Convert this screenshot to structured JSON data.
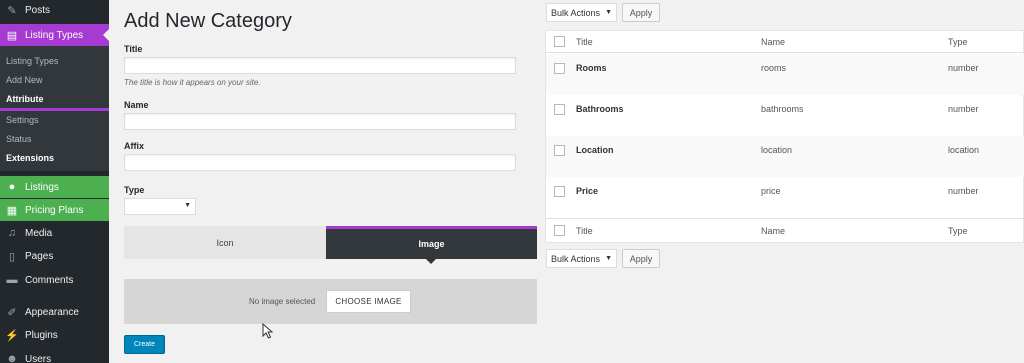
{
  "sidebar": {
    "posts": "Posts",
    "listing_types": "Listing Types",
    "sub_items": [
      "Listing Types",
      "Add New",
      "Attribute",
      "Settings",
      "Status",
      "Extensions"
    ],
    "listings": "Listings",
    "pricing_plans": "Pricing Plans",
    "media": "Media",
    "pages": "Pages",
    "comments": "Comments",
    "appearance": "Appearance",
    "plugins": "Plugins",
    "users": "Users"
  },
  "form": {
    "heading": "Add New Category",
    "title_label": "Title",
    "title_value": "",
    "title_hint": "The title is how it appears on your site.",
    "name_label": "Name",
    "name_value": "",
    "affix_label": "Affix",
    "affix_value": "",
    "type_label": "Type",
    "type_value": "",
    "tab_icon": "Icon",
    "tab_image": "Image",
    "no_image": "No image selected",
    "choose_image": "CHOOSE IMAGE",
    "create": "Create"
  },
  "table": {
    "bulk_actions": "Bulk Actions",
    "apply": "Apply",
    "columns": [
      "Title",
      "Name",
      "Type"
    ],
    "rows": [
      {
        "title": "Rooms",
        "name": "rooms",
        "type": "number"
      },
      {
        "title": "Bathrooms",
        "name": "bathrooms",
        "type": "number"
      },
      {
        "title": "Location",
        "name": "location",
        "type": "location"
      },
      {
        "title": "Price",
        "name": "price",
        "type": "number"
      }
    ]
  },
  "colors": {
    "accent_purple": "#a53bd2",
    "accent_green": "#4caf50",
    "sidebar_bg": "#23282d",
    "primary_blue": "#0085ba"
  }
}
